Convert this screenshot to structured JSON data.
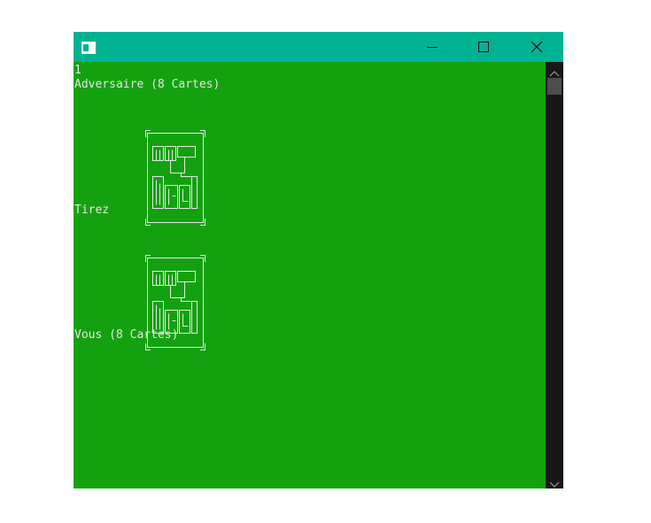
{
  "window": {
    "titlebar_color": "#00b294",
    "console_background": "#14a10f",
    "icons": {
      "app": "console-app-icon",
      "minimize": "minimize-icon",
      "maximize": "maximize-icon",
      "close": "close-icon"
    }
  },
  "console": {
    "line_counter": "1",
    "opponent_label": "Adversaire (8 Cartes)",
    "draw_label": "Tirez",
    "player_label": "Vous (8 Cartes)",
    "cards": [
      "card-back",
      "card-back"
    ]
  },
  "scrollbar": {
    "up_icon": "chevron-up-icon",
    "down_icon": "chevron-down-icon"
  }
}
